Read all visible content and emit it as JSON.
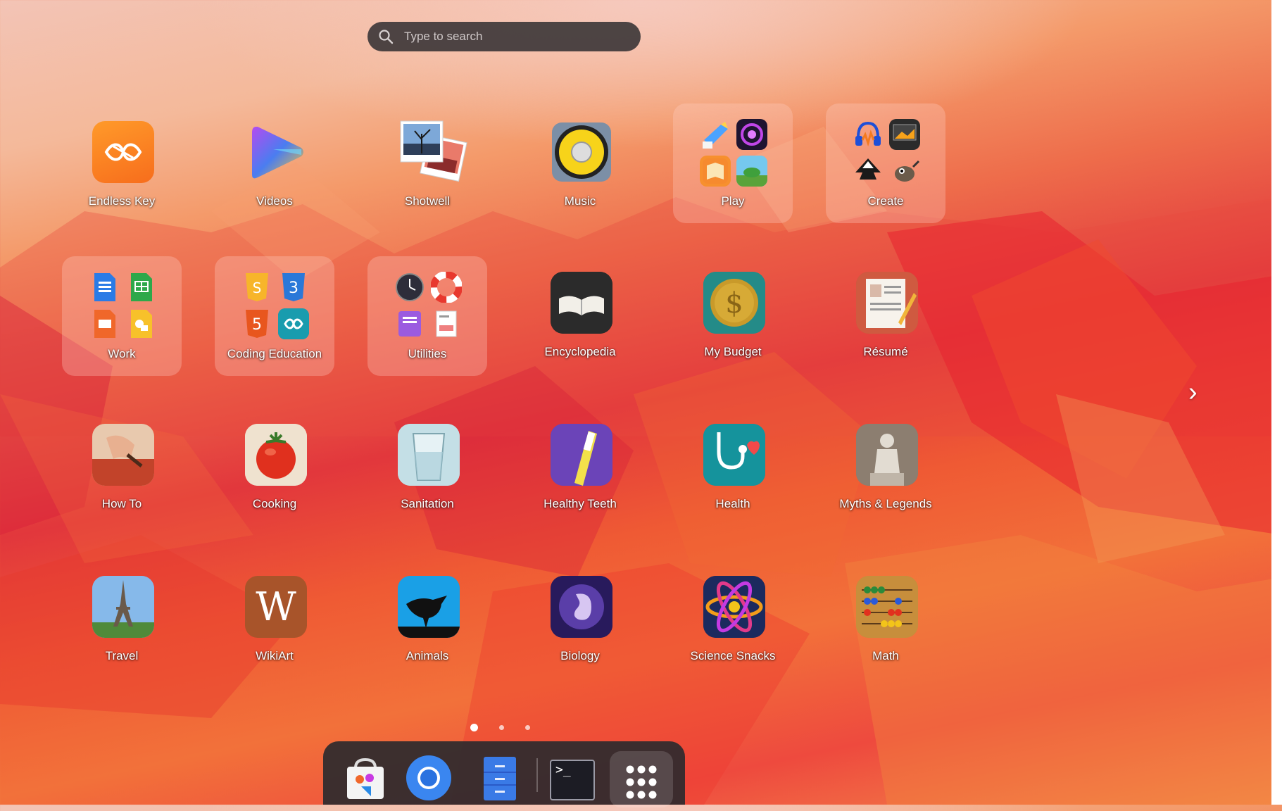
{
  "search": {
    "placeholder": "Type to search"
  },
  "apps": [
    {
      "id": "endless-key",
      "label": "Endless Key"
    },
    {
      "id": "videos",
      "label": "Videos"
    },
    {
      "id": "shotwell",
      "label": "Shotwell"
    },
    {
      "id": "music",
      "label": "Music"
    },
    {
      "id": "play",
      "label": "Play",
      "folder": true
    },
    {
      "id": "create",
      "label": "Create",
      "folder": true
    },
    {
      "id": "work",
      "label": "Work",
      "folder": true
    },
    {
      "id": "coding-education",
      "label": "Coding Education",
      "folder": true
    },
    {
      "id": "utilities",
      "label": "Utilities",
      "folder": true
    },
    {
      "id": "encyclopedia",
      "label": "Encyclopedia"
    },
    {
      "id": "my-budget",
      "label": "My Budget"
    },
    {
      "id": "resume",
      "label": "Résumé"
    },
    {
      "id": "how-to",
      "label": "How To"
    },
    {
      "id": "cooking",
      "label": "Cooking"
    },
    {
      "id": "sanitation",
      "label": "Sanitation"
    },
    {
      "id": "healthy-teeth",
      "label": "Healthy Teeth"
    },
    {
      "id": "health",
      "label": "Health"
    },
    {
      "id": "myths-legends",
      "label": "Myths & Legends"
    },
    {
      "id": "travel",
      "label": "Travel"
    },
    {
      "id": "wikiart",
      "label": "WikiArt"
    },
    {
      "id": "animals",
      "label": "Animals"
    },
    {
      "id": "biology",
      "label": "Biology"
    },
    {
      "id": "science-snacks",
      "label": "Science Snacks"
    },
    {
      "id": "math",
      "label": "Math"
    }
  ],
  "wikiart_glyph": "W",
  "next_arrow": "›",
  "pager": {
    "pages": 3,
    "current": 1
  },
  "dock": {
    "items": [
      {
        "id": "app-center",
        "icon": "store-bag-icon"
      },
      {
        "id": "chromium",
        "icon": "chromium-icon"
      },
      {
        "id": "files",
        "icon": "file-cabinet-icon"
      },
      {
        "id": "terminal",
        "icon": "terminal-icon"
      },
      {
        "id": "show-apps",
        "icon": "app-grid-icon"
      }
    ],
    "terminal_prompt": ">_"
  },
  "colors": {
    "accent_orange": "#f7772a",
    "dock_bg": "#2d2a2e",
    "search_bg": "#3e383a"
  }
}
